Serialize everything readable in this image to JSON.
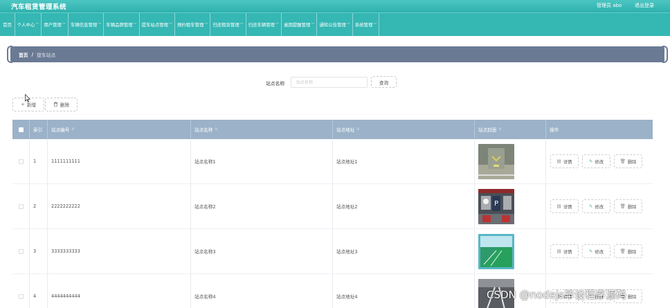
{
  "header": {
    "app_title": "汽车租赁管理系统",
    "user_label": "管理员 abo",
    "logout_label": "退出登录"
  },
  "nav": {
    "items": [
      {
        "label": "首页",
        "dropdown": false
      },
      {
        "label": "个人中心",
        "dropdown": true
      },
      {
        "label": "用户管理",
        "dropdown": true
      },
      {
        "label": "车辆信息管理",
        "dropdown": true
      },
      {
        "label": "车辆品牌管理",
        "dropdown": true
      },
      {
        "label": "提车站点管理",
        "dropdown": true
      },
      {
        "label": "预约租车管理",
        "dropdown": true
      },
      {
        "label": "归还租赁管理",
        "dropdown": true
      },
      {
        "label": "归还车辆管理",
        "dropdown": true
      },
      {
        "label": "逾期提醒管理",
        "dropdown": true
      },
      {
        "label": "通知公告管理",
        "dropdown": true
      },
      {
        "label": "系统管理",
        "dropdown": true
      }
    ]
  },
  "breadcrumb": {
    "home": "首页",
    "separator": "/",
    "current": "提车站点"
  },
  "search": {
    "label": "站点名称",
    "placeholder": "站点名称",
    "button_label": "查询"
  },
  "toolbar": {
    "add_label": "新增",
    "delete_label": "删除"
  },
  "table": {
    "columns": [
      "索引",
      "站点编号",
      "站点名称",
      "站点地址",
      "站点封面",
      "操作"
    ],
    "rows": [
      {
        "index": "1",
        "code": "1111111111",
        "name": "站点名称1",
        "address": "站点地址1",
        "cover": "parking-lot-photo"
      },
      {
        "index": "2",
        "code": "2222222222",
        "name": "站点名称2",
        "address": "站点地址2",
        "cover": "parking-sign-photo"
      },
      {
        "index": "3",
        "code": "3333333333",
        "name": "站点名称3",
        "address": "站点地址3",
        "cover": "green-garage-photo"
      },
      {
        "index": "4",
        "code": "4444444444",
        "name": "站点名称4",
        "address": "站点地址4",
        "cover": "road-photo"
      }
    ],
    "actions": {
      "detail": "详情",
      "edit": "修改",
      "delete": "删除"
    }
  },
  "watermark": "CSDN @nodejs毕设程序源码",
  "colors": {
    "header_teal": "#2fb1ad",
    "breadcrumb_bg": "#6b7a94",
    "table_header_bg": "#9bb2c8"
  }
}
